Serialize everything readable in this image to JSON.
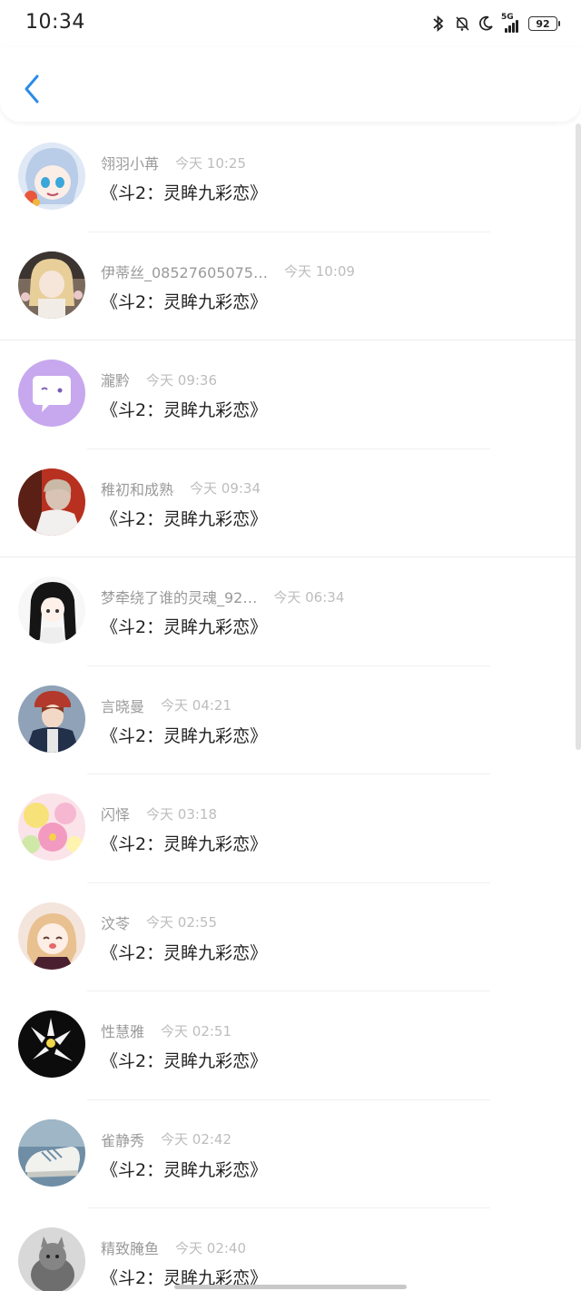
{
  "status_bar": {
    "time": "10:34",
    "network": "5G",
    "battery": "92",
    "icons": [
      "bluetooth-icon",
      "mute-icon",
      "moon-icon",
      "signal-icon",
      "battery-icon"
    ]
  },
  "header": {
    "back_icon": "back-chevron-icon",
    "accent": "#2b8ce6"
  },
  "messages": [
    {
      "name": "翎羽小苒",
      "time": "今天 10:25",
      "text": "《斗2：灵眸九彩恋》",
      "avatar": "anime-girl-blue-hair"
    },
    {
      "name": "伊蒂丝_08527605075…",
      "time": "今天 10:09",
      "text": "《斗2：灵眸九彩恋》",
      "avatar": "anime-girl-gold"
    },
    {
      "name": "瀧黔",
      "time": "今天 09:36",
      "text": "《斗2：灵眸九彩恋》",
      "avatar": "purple-chat-bubble"
    },
    {
      "name": "稚初和成熟",
      "time": "今天 09:34",
      "text": "《斗2：灵眸九彩恋》",
      "avatar": "photo-person"
    },
    {
      "name": "梦牵绕了谁的灵魂_92…",
      "time": "今天 06:34",
      "text": "《斗2：灵眸九彩恋》",
      "avatar": "anime-girl-black-hair"
    },
    {
      "name": "言晓曼",
      "time": "今天 04:21",
      "text": "《斗2：灵眸九彩恋》",
      "avatar": "anime-boy-red-hat"
    },
    {
      "name": "闪怿",
      "time": "今天 03:18",
      "text": "《斗2：灵眸九彩恋》",
      "avatar": "flowers-pastel"
    },
    {
      "name": "汶苓",
      "time": "今天 02:55",
      "text": "《斗2：灵眸九彩恋》",
      "avatar": "anime-girl-pink"
    },
    {
      "name": "性慧雅",
      "time": "今天 02:51",
      "text": "《斗2：灵眸九彩恋》",
      "avatar": "white-orchid-dark"
    },
    {
      "name": "雀静秀",
      "time": "今天 02:42",
      "text": "《斗2：灵眸九彩恋》",
      "avatar": "sneaker-photo"
    },
    {
      "name": "精致腌鱼",
      "time": "今天 02:40",
      "text": "《斗2：灵眸九彩恋》",
      "avatar": "cat-photo-gray"
    }
  ]
}
